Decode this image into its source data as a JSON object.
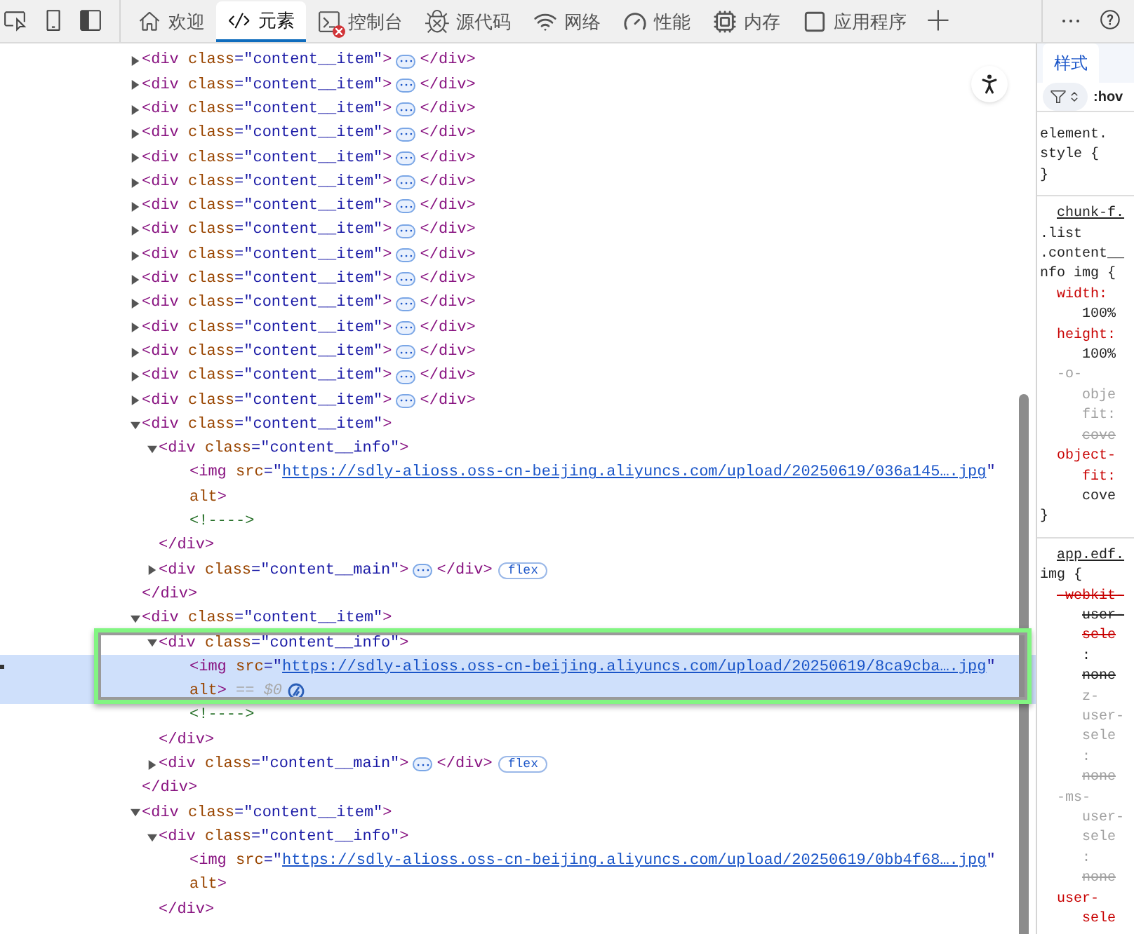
{
  "toolbar": {
    "tabs": [
      {
        "label": "欢迎",
        "selected": false,
        "alert": false
      },
      {
        "label": "元素",
        "selected": true,
        "alert": false
      },
      {
        "label": "控制台",
        "selected": false,
        "alert": true
      },
      {
        "label": "源代码",
        "selected": false,
        "alert": false
      },
      {
        "label": "网络",
        "selected": false,
        "alert": false
      },
      {
        "label": "性能",
        "selected": false,
        "alert": false
      },
      {
        "label": "内存",
        "selected": false,
        "alert": false
      },
      {
        "label": "应用程序",
        "selected": false,
        "alert": false
      }
    ]
  },
  "dom_tree": [
    {
      "lines": [
        [
          {
            "kind": "tag",
            "t": "<div "
          },
          {
            "kind": "attr",
            "t": "class"
          },
          {
            "kind": "value",
            "t": "=\"content__item\""
          },
          {
            "kind": "tag",
            "t": ">"
          }
        ]
      ],
      "expanded": false,
      "close": [
        {
          "kind": "tag",
          "t": "</div>"
        }
      ]
    },
    {
      "lines": [
        [
          {
            "kind": "tag",
            "t": "<div "
          },
          {
            "kind": "attr",
            "t": "class"
          },
          {
            "kind": "value",
            "t": "=\"content__item\""
          },
          {
            "kind": "tag",
            "t": ">"
          }
        ]
      ],
      "expanded": false,
      "close": [
        {
          "kind": "tag",
          "t": "</div>"
        }
      ]
    },
    {
      "lines": [
        [
          {
            "kind": "tag",
            "t": "<div "
          },
          {
            "kind": "attr",
            "t": "class"
          },
          {
            "kind": "value",
            "t": "=\"content__item\""
          },
          {
            "kind": "tag",
            "t": ">"
          }
        ]
      ],
      "expanded": false,
      "close": [
        {
          "kind": "tag",
          "t": "</div>"
        }
      ]
    },
    {
      "lines": [
        [
          {
            "kind": "tag",
            "t": "<div "
          },
          {
            "kind": "attr",
            "t": "class"
          },
          {
            "kind": "value",
            "t": "=\"content__item\""
          },
          {
            "kind": "tag",
            "t": ">"
          }
        ]
      ],
      "expanded": false,
      "close": [
        {
          "kind": "tag",
          "t": "</div>"
        }
      ]
    },
    {
      "lines": [
        [
          {
            "kind": "tag",
            "t": "<div "
          },
          {
            "kind": "attr",
            "t": "class"
          },
          {
            "kind": "value",
            "t": "=\"content__item\""
          },
          {
            "kind": "tag",
            "t": ">"
          }
        ]
      ],
      "expanded": false,
      "close": [
        {
          "kind": "tag",
          "t": "</div>"
        }
      ]
    },
    {
      "lines": [
        [
          {
            "kind": "tag",
            "t": "<div "
          },
          {
            "kind": "attr",
            "t": "class"
          },
          {
            "kind": "value",
            "t": "=\"content__item\""
          },
          {
            "kind": "tag",
            "t": ">"
          }
        ]
      ],
      "expanded": false,
      "close": [
        {
          "kind": "tag",
          "t": "</div>"
        }
      ]
    },
    {
      "lines": [
        [
          {
            "kind": "tag",
            "t": "<div "
          },
          {
            "kind": "attr",
            "t": "class"
          },
          {
            "kind": "value",
            "t": "=\"content__item\""
          },
          {
            "kind": "tag",
            "t": ">"
          }
        ]
      ],
      "expanded": false,
      "close": [
        {
          "kind": "tag",
          "t": "</div>"
        }
      ]
    },
    {
      "lines": [
        [
          {
            "kind": "tag",
            "t": "<div "
          },
          {
            "kind": "attr",
            "t": "class"
          },
          {
            "kind": "value",
            "t": "=\"content__item\""
          },
          {
            "kind": "tag",
            "t": ">"
          }
        ]
      ],
      "expanded": false,
      "close": [
        {
          "kind": "tag",
          "t": "</div>"
        }
      ]
    },
    {
      "lines": [
        [
          {
            "kind": "tag",
            "t": "<div "
          },
          {
            "kind": "attr",
            "t": "class"
          },
          {
            "kind": "value",
            "t": "=\"content__item\""
          },
          {
            "kind": "tag",
            "t": ">"
          }
        ]
      ],
      "expanded": false,
      "close": [
        {
          "kind": "tag",
          "t": "</div>"
        }
      ]
    },
    {
      "lines": [
        [
          {
            "kind": "tag",
            "t": "<div "
          },
          {
            "kind": "attr",
            "t": "class"
          },
          {
            "kind": "value",
            "t": "=\"content__item\""
          },
          {
            "kind": "tag",
            "t": ">"
          }
        ]
      ],
      "expanded": false,
      "close": [
        {
          "kind": "tag",
          "t": "</div>"
        }
      ]
    },
    {
      "lines": [
        [
          {
            "kind": "tag",
            "t": "<div "
          },
          {
            "kind": "attr",
            "t": "class"
          },
          {
            "kind": "value",
            "t": "=\"content__item\""
          },
          {
            "kind": "tag",
            "t": ">"
          }
        ]
      ],
      "expanded": false,
      "close": [
        {
          "kind": "tag",
          "t": "</div>"
        }
      ]
    },
    {
      "lines": [
        [
          {
            "kind": "tag",
            "t": "<div "
          },
          {
            "kind": "attr",
            "t": "class"
          },
          {
            "kind": "value",
            "t": "=\"content__item\""
          },
          {
            "kind": "tag",
            "t": ">"
          }
        ]
      ],
      "expanded": false,
      "close": [
        {
          "kind": "tag",
          "t": "</div>"
        }
      ]
    },
    {
      "lines": [
        [
          {
            "kind": "tag",
            "t": "<div "
          },
          {
            "kind": "attr",
            "t": "class"
          },
          {
            "kind": "value",
            "t": "=\"content__item\""
          },
          {
            "kind": "tag",
            "t": ">"
          }
        ]
      ],
      "expanded": false,
      "close": [
        {
          "kind": "tag",
          "t": "</div>"
        }
      ]
    },
    {
      "lines": [
        [
          {
            "kind": "tag",
            "t": "<div "
          },
          {
            "kind": "attr",
            "t": "class"
          },
          {
            "kind": "value",
            "t": "=\"content__item\""
          },
          {
            "kind": "tag",
            "t": ">"
          }
        ]
      ],
      "expanded": false,
      "close": [
        {
          "kind": "tag",
          "t": "</div>"
        }
      ]
    },
    {
      "lines": [
        [
          {
            "kind": "tag",
            "t": "<div "
          },
          {
            "kind": "attr",
            "t": "class"
          },
          {
            "kind": "value",
            "t": "=\"content__item\""
          },
          {
            "kind": "tag",
            "t": ">"
          }
        ]
      ],
      "expanded": false,
      "close": [
        {
          "kind": "tag",
          "t": "</div>"
        }
      ]
    },
    {
      "lines": [
        [
          {
            "kind": "tag",
            "t": "<div "
          },
          {
            "kind": "attr",
            "t": "class"
          },
          {
            "kind": "value",
            "t": "=\"content__item\""
          },
          {
            "kind": "tag",
            "t": ">"
          }
        ]
      ],
      "expanded": true,
      "close": [
        {
          "kind": "tag",
          "t": "</div>"
        }
      ],
      "children": [
        {
          "lines": [
            [
              {
                "kind": "tag",
                "t": "<div "
              },
              {
                "kind": "attr",
                "t": "class"
              },
              {
                "kind": "value",
                "t": "=\"content__info\""
              },
              {
                "kind": "tag",
                "t": ">"
              }
            ]
          ],
          "expanded": true,
          "close": [
            {
              "kind": "tag",
              "t": "</div>"
            }
          ],
          "children": [
            {
              "lines": [
                [
                  {
                    "kind": "tag",
                    "t": "<img "
                  },
                  {
                    "kind": "attr",
                    "t": "src"
                  },
                  {
                    "kind": "value",
                    "t": "=\""
                  },
                  {
                    "kind": "link",
                    "t": "https://sdly-alioss.oss-cn-beijing.aliyuncs.com/upload/20250619/036a145….jpg"
                  },
                  {
                    "kind": "value",
                    "t": "\""
                  }
                ],
                [
                  {
                    "kind": "attr",
                    "t": "alt"
                  },
                  {
                    "kind": "tag",
                    "t": ">"
                  }
                ]
              ],
              "selected": false
            },
            {
              "lines": [
                [
                  {
                    "kind": "comment",
                    "t": "<!---->"
                  }
                ]
              ],
              "selected": false
            }
          ]
        },
        {
          "lines": [
            [
              {
                "kind": "tag",
                "t": "<div "
              },
              {
                "kind": "attr",
                "t": "class"
              },
              {
                "kind": "value",
                "t": "=\"content__main\""
              },
              {
                "kind": "tag",
                "t": ">"
              }
            ]
          ],
          "expanded": false,
          "close": [
            {
              "kind": "tag",
              "t": "</div>"
            }
          ],
          "badge": "flex"
        }
      ]
    },
    {
      "lines": [
        [
          {
            "kind": "tag",
            "t": "<div "
          },
          {
            "kind": "attr",
            "t": "class"
          },
          {
            "kind": "value",
            "t": "=\"content__item\""
          },
          {
            "kind": "tag",
            "t": ">"
          }
        ]
      ],
      "expanded": true,
      "close": [
        {
          "kind": "tag",
          "t": "</div>"
        }
      ],
      "children": [
        {
          "lines": [
            [
              {
                "kind": "tag",
                "t": "<div "
              },
              {
                "kind": "attr",
                "t": "class"
              },
              {
                "kind": "value",
                "t": "=\"content__info\""
              },
              {
                "kind": "tag",
                "t": ">"
              }
            ]
          ],
          "expanded": true,
          "close": [
            {
              "kind": "tag",
              "t": "</div>"
            }
          ],
          "children": [
            {
              "lines": [
                [
                  {
                    "kind": "tag",
                    "t": "<img "
                  },
                  {
                    "kind": "attr",
                    "t": "src"
                  },
                  {
                    "kind": "value",
                    "t": "=\""
                  },
                  {
                    "kind": "link",
                    "t": "https://sdly-alioss.oss-cn-beijing.aliyuncs.com/upload/20250619/8ca9cba….jpg"
                  },
                  {
                    "kind": "value",
                    "t": "\""
                  }
                ],
                [
                  {
                    "kind": "attr",
                    "t": "alt"
                  },
                  {
                    "kind": "tag",
                    "t": ">"
                  },
                  {
                    "kind": "dim",
                    "t": " == $0"
                  }
                ]
              ],
              "selected": true
            },
            {
              "lines": [
                [
                  {
                    "kind": "comment",
                    "t": "<!---->"
                  }
                ]
              ],
              "selected": false
            }
          ]
        },
        {
          "lines": [
            [
              {
                "kind": "tag",
                "t": "<div "
              },
              {
                "kind": "attr",
                "t": "class"
              },
              {
                "kind": "value",
                "t": "=\"content__main\""
              },
              {
                "kind": "tag",
                "t": ">"
              }
            ]
          ],
          "expanded": false,
          "close": [
            {
              "kind": "tag",
              "t": "</div>"
            }
          ],
          "badge": "flex"
        }
      ]
    },
    {
      "lines": [
        [
          {
            "kind": "tag",
            "t": "<div "
          },
          {
            "kind": "attr",
            "t": "class"
          },
          {
            "kind": "value",
            "t": "=\"content__item\""
          },
          {
            "kind": "tag",
            "t": ">"
          }
        ]
      ],
      "expanded": true,
      "children": [
        {
          "lines": [
            [
              {
                "kind": "tag",
                "t": "<div "
              },
              {
                "kind": "attr",
                "t": "class"
              },
              {
                "kind": "value",
                "t": "=\"content__info\""
              },
              {
                "kind": "tag",
                "t": ">"
              }
            ]
          ],
          "expanded": true,
          "close": [
            {
              "kind": "tag",
              "t": "</div>"
            }
          ],
          "children": [
            {
              "lines": [
                [
                  {
                    "kind": "tag",
                    "t": "<img "
                  },
                  {
                    "kind": "attr",
                    "t": "src"
                  },
                  {
                    "kind": "value",
                    "t": "=\""
                  },
                  {
                    "kind": "link",
                    "t": "https://sdly-alioss.oss-cn-beijing.aliyuncs.com/upload/20250619/0bb4f68….jpg"
                  },
                  {
                    "kind": "value",
                    "t": "\""
                  }
                ],
                [
                  {
                    "kind": "attr",
                    "t": "alt"
                  },
                  {
                    "kind": "tag",
                    "t": ">"
                  }
                ]
              ],
              "selected": false
            }
          ]
        }
      ]
    }
  ],
  "styles_panel": {
    "tabs": [
      {
        "label": "样式",
        "selected": true
      }
    ],
    "filter": ":hov",
    "rules": [
      {
        "lines": [
          {
            "kind": "sel",
            "t": "element."
          },
          {
            "kind": "sel",
            "t": "style {"
          },
          {
            "kind": "sel",
            "t": "}"
          }
        ]
      },
      {
        "source": "chunk-f.",
        "lines": [
          {
            "kind": "sel",
            "t": ".list"
          },
          {
            "kind": "sel",
            "t": ".content__"
          },
          {
            "kind": "sel",
            "t": "nfo img {"
          },
          {
            "kind": "prop",
            "t": "width:"
          },
          {
            "kind": "value",
            "t": "100%"
          },
          {
            "kind": "prop",
            "t": "height:"
          },
          {
            "kind": "value",
            "t": "100%"
          },
          {
            "kind": "dimprop",
            "t": "-o-"
          },
          {
            "kind": "dim",
            "t": "obje"
          },
          {
            "kind": "dim",
            "t": "fit:"
          },
          {
            "kind": "dim",
            "t": "cove",
            "struck": true
          },
          {
            "kind": "prop",
            "t": "object-"
          },
          {
            "kind": "propwrap",
            "t": "fit:"
          },
          {
            "kind": "value",
            "t": "cove"
          },
          {
            "kind": "sel",
            "t": "}"
          }
        ]
      },
      {
        "source": "app.edf.",
        "lines": [
          {
            "kind": "sel",
            "t": "img {"
          },
          {
            "kind": "prop",
            "t": "-webkit-",
            "struck": true
          },
          {
            "kind": "value",
            "t": "user-",
            "struck": true
          },
          {
            "kind": "propwrap",
            "t": "sele",
            "struck": true
          },
          {
            "kind": "value",
            "t": ":"
          },
          {
            "kind": "value",
            "t": "none",
            "struck": true
          },
          {
            "kind": "dim",
            "t": "z-"
          },
          {
            "kind": "dim",
            "t": "user-"
          },
          {
            "kind": "dim",
            "t": "sele"
          },
          {
            "kind": "dim",
            "t": ":"
          },
          {
            "kind": "dim",
            "t": "none",
            "struck": true
          },
          {
            "kind": "dimprop",
            "t": "-ms-"
          },
          {
            "kind": "dim",
            "t": "user-"
          },
          {
            "kind": "dim",
            "t": "sele"
          },
          {
            "kind": "dim",
            "t": ":"
          },
          {
            "kind": "dim",
            "t": "none",
            "struck": true
          },
          {
            "kind": "prop",
            "t": "user-"
          },
          {
            "kind": "propwrap",
            "t": "sele"
          }
        ]
      }
    ]
  }
}
